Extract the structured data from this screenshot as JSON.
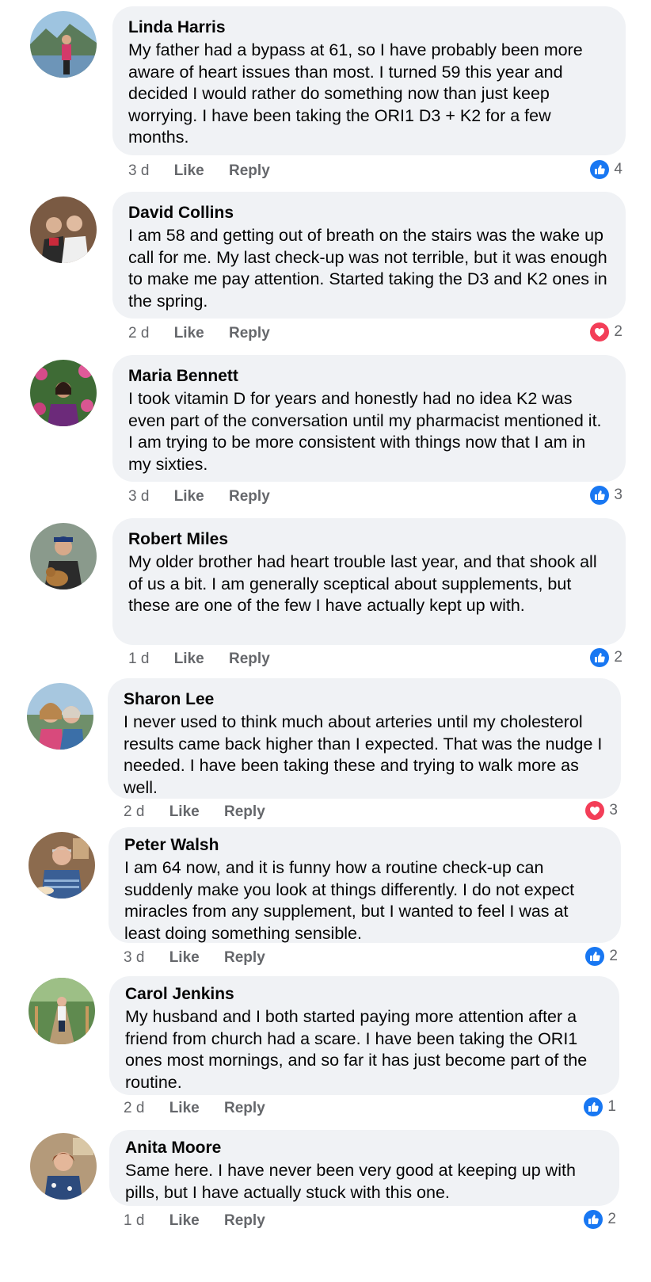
{
  "colors": {
    "bubble": "#f0f2f5",
    "like": "#1877f2",
    "love": "#f33e58",
    "meta_text": "#65676b"
  },
  "actions": {
    "like_label": "Like",
    "reply_label": "Reply"
  },
  "comments": [
    {
      "author": "Linda Harris",
      "text": "My father had a bypass at 61, so I have probably been more aware of heart issues than most. I turned 59 this year and decided I would rather do something now than just keep worrying. I have been taking the ORI1 D3 + K2 for a few months.",
      "time": "3 d",
      "reaction_icon": "like-icon",
      "reaction_count": "4"
    },
    {
      "author": "David Collins",
      "text": "I am 58 and getting out of breath on the stairs was the wake up call for me. My last check-up was not terrible, but it was enough to make me pay attention. Started taking the D3 and K2 ones in the spring.",
      "time": "2 d",
      "reaction_icon": "love-icon",
      "reaction_count": "2"
    },
    {
      "author": "Maria Bennett",
      "text": "I took vitamin D for years and honestly had no idea K2 was even part of the conversation until my pharmacist mentioned it. I am trying to be more consistent with things now that I am in my sixties.",
      "time": "3 d",
      "reaction_icon": "like-icon",
      "reaction_count": "3"
    },
    {
      "author": "Robert Miles",
      "text": "My older brother had heart trouble last year, and that shook all of us a bit. I am generally sceptical about supplements, but these are one of the few I have actually kept up with.",
      "time": "1 d",
      "reaction_icon": "like-icon",
      "reaction_count": "2"
    },
    {
      "author": "Sharon Lee",
      "text": "I never used to think much about arteries until my cholesterol results came back higher than I expected. That was the nudge I needed. I have been taking these and trying to walk more as well.",
      "time": "2 d",
      "reaction_icon": "love-icon",
      "reaction_count": "3"
    },
    {
      "author": "Peter Walsh",
      "text": "I am 64 now, and it is funny how a routine check-up can suddenly make you look at things differently. I do not expect miracles from any supplement, but I wanted to feel I was at least doing something sensible.",
      "time": "3 d",
      "reaction_icon": "like-icon",
      "reaction_count": "2"
    },
    {
      "author": "Carol Jenkins",
      "text": "My husband and I both started paying more attention after a friend from church had a scare. I have been taking the ORI1 ones most mornings, and so far it has just become part of the routine.",
      "time": "2 d",
      "reaction_icon": "like-icon",
      "reaction_count": "1"
    },
    {
      "author": "Anita Moore",
      "text": "Same here. I have never been very good at keeping up with pills, but I have actually stuck with this one.",
      "time": "1 d",
      "reaction_icon": "like-icon",
      "reaction_count": "2"
    }
  ]
}
